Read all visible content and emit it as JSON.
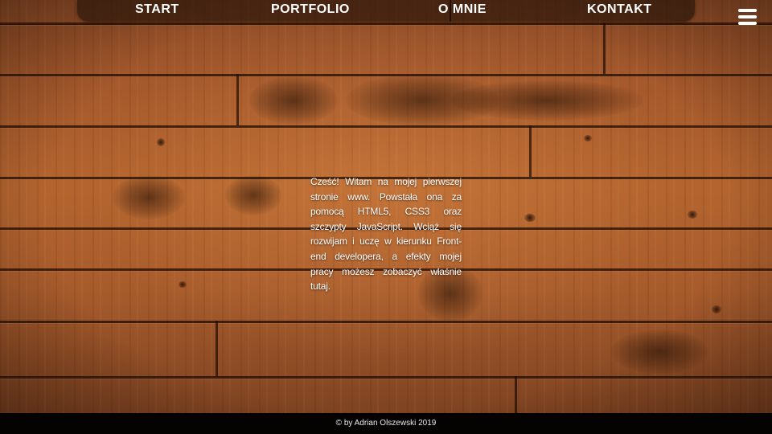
{
  "nav": {
    "items": [
      {
        "label": "START"
      },
      {
        "label": "PORTFOLIO"
      },
      {
        "label": "O MNIE"
      },
      {
        "label": "KONTAKT"
      }
    ],
    "menu_icon": "hamburger-menu-icon"
  },
  "main": {
    "intro_text": "Cześć! Witam na mojej pierwszej stronie www. Powstała ona za pomocą HTML5, CSS3 oraz szczypty JavaScript. Wciąż się rozwijam i uczę w kierunku Front-end developera, a efekty mojej pracy możesz zobaczyć właśnie tutaj."
  },
  "footer": {
    "copyright": "© by Adrian Olszewski 2019"
  },
  "colors": {
    "wood": "#a5592c",
    "nav_background": "#2d160a",
    "footer_background": "#050302",
    "text": "#ffffff"
  }
}
